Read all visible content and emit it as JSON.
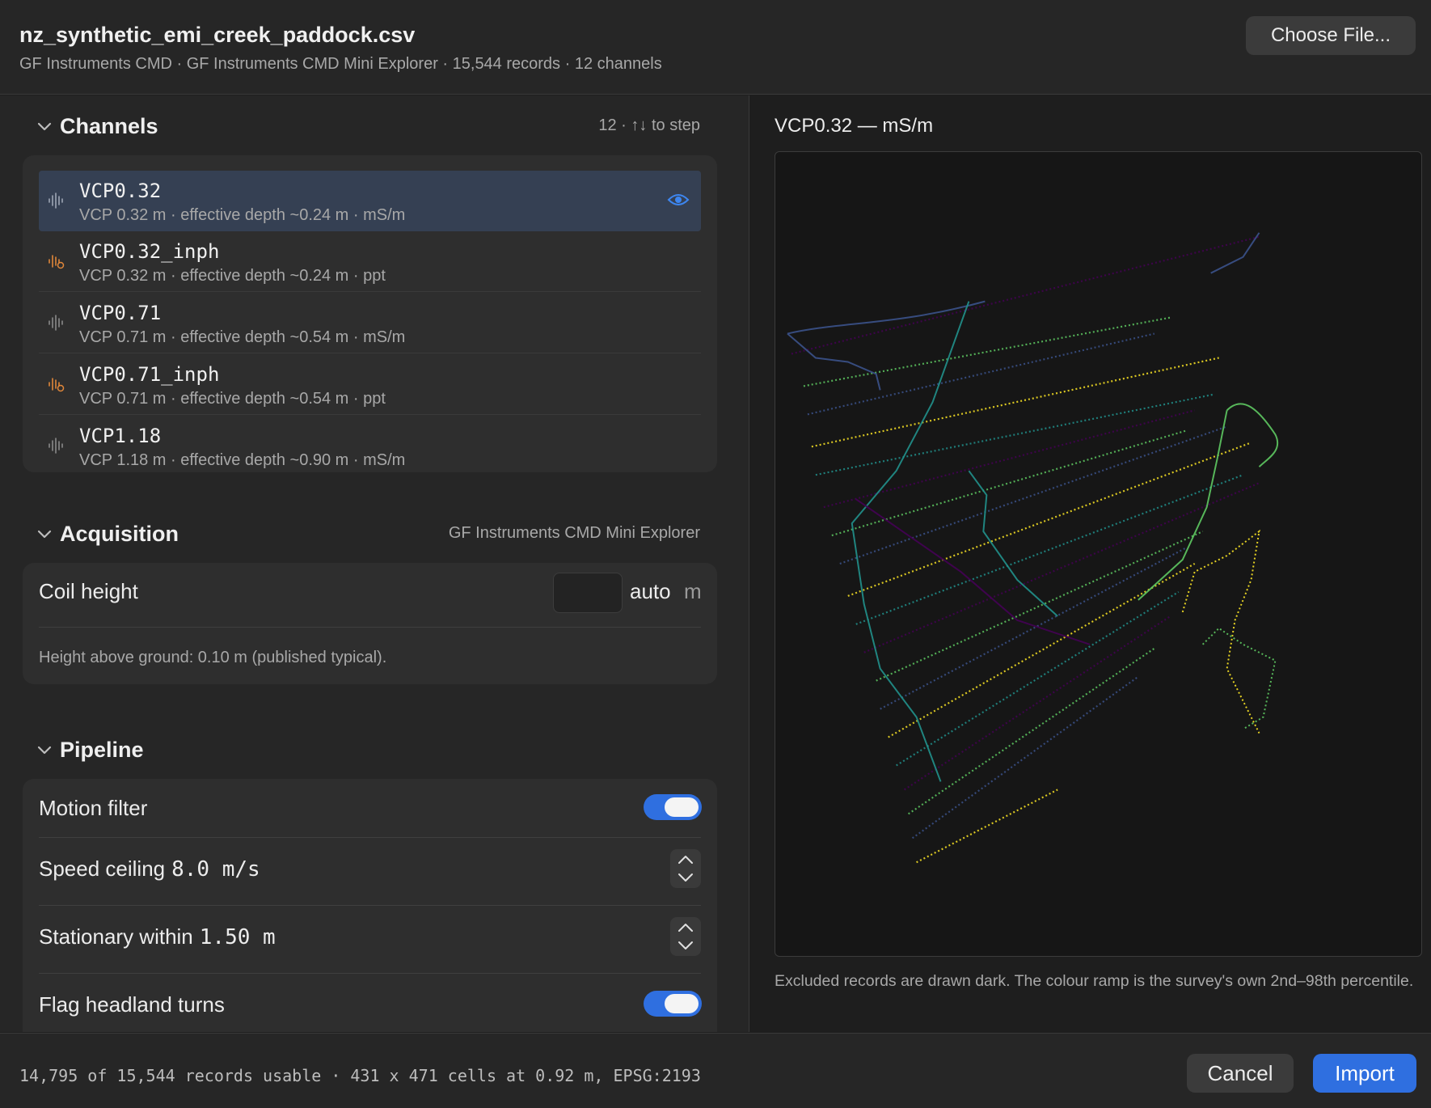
{
  "header": {
    "file_name": "nz_synthetic_emi_creek_paddock.csv",
    "subtitle": "GF Instruments CMD · GF Instruments CMD Mini Explorer · 15,544 records · 12 channels",
    "choose_file_label": "Choose File..."
  },
  "channels": {
    "title": "Channels",
    "meta": "12 · ↑↓ to step",
    "items": [
      {
        "name": "VCP0.32",
        "desc": "VCP 0.32 m · effective depth ~0.24 m · mS/m",
        "icon": "waveform-icon",
        "selected": true
      },
      {
        "name": "VCP0.32_inph",
        "desc": "VCP 0.32 m · effective depth ~0.24 m · ppt",
        "icon": "waveform-badge-icon",
        "selected": false
      },
      {
        "name": "VCP0.71",
        "desc": "VCP 0.71 m · effective depth ~0.54 m · mS/m",
        "icon": "waveform-icon",
        "selected": false
      },
      {
        "name": "VCP0.71_inph",
        "desc": "VCP 0.71 m · effective depth ~0.54 m · ppt",
        "icon": "waveform-badge-icon",
        "selected": false
      },
      {
        "name": "VCP1.18",
        "desc": "VCP 1.18 m · effective depth ~0.90 m · mS/m",
        "icon": "waveform-icon",
        "selected": false
      }
    ]
  },
  "acquisition": {
    "title": "Acquisition",
    "meta": "GF Instruments CMD Mini Explorer",
    "coil_height_label": "Coil height",
    "coil_height_value": "",
    "coil_height_placeholder": "auto",
    "coil_height_unit": "m",
    "help": "Height above ground: 0.10 m (published typical)."
  },
  "pipeline": {
    "title": "Pipeline",
    "motion_filter_label": "Motion filter",
    "motion_filter_on": true,
    "speed_ceiling_label": "Speed ceiling",
    "speed_ceiling_value": "8.0 m/s",
    "stationary_label": "Stationary within",
    "stationary_value": "1.50 m",
    "headland_label": "Flag headland turns",
    "headland_on": true
  },
  "preview": {
    "title": "VCP0.32 — mS/m",
    "note": "Excluded records are drawn dark. The colour ramp is the survey's own 2nd–98th percentile."
  },
  "footer": {
    "status": "14,795 of 15,544 records usable · 431 x 471 cells at 0.92 m, EPSG:2193",
    "cancel_label": "Cancel",
    "import_label": "Import"
  },
  "colors": {
    "accent": "#2f6fe0",
    "selected_row": "#354053",
    "inph_icon": "#e0873a",
    "ramp": [
      "#440154",
      "#3b528b",
      "#21918c",
      "#5ec962",
      "#fde725"
    ]
  }
}
